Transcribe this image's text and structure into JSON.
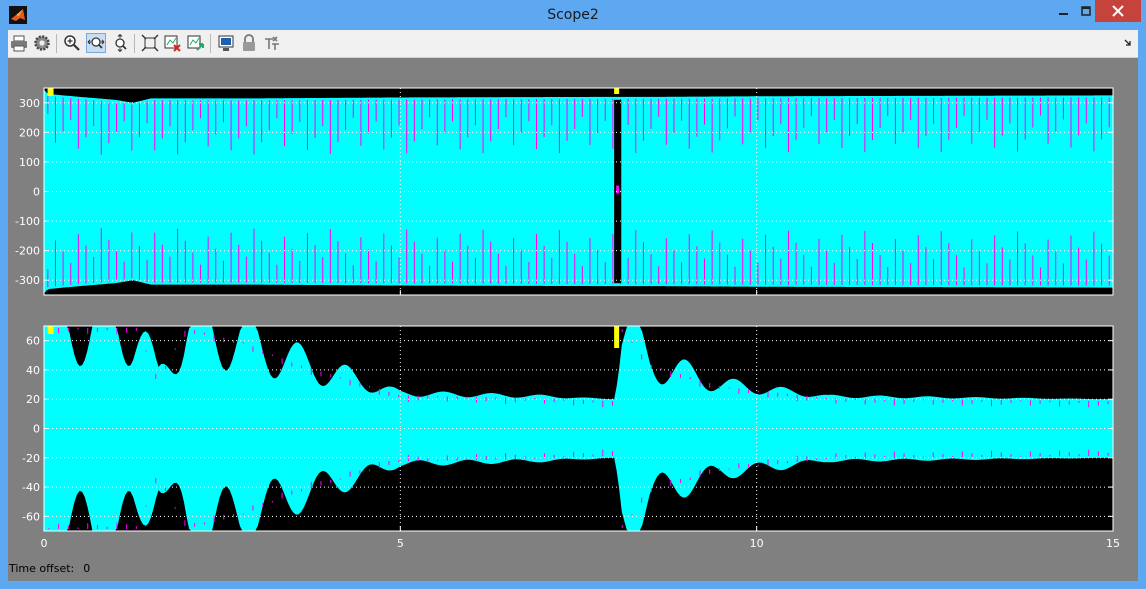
{
  "window": {
    "title": "Scope2"
  },
  "toolbar": {
    "buttons": [
      "printer-icon",
      "parameters-icon",
      "zoom-in-icon",
      "zoom-x-icon",
      "zoom-y-icon",
      "autoscale-icon",
      "save-axes-icon",
      "restore-axes-icon",
      "floating-scope-icon",
      "lock-axes-icon",
      "signal-selection-icon"
    ],
    "active": "zoom-x-icon"
  },
  "status": {
    "time_offset_label": "Time offset:",
    "time_offset_value": "0"
  },
  "colors": {
    "background": "#000000",
    "grid": "#ffffff",
    "cyan": "#00ffff",
    "magenta": "#ff00ff",
    "yellow": "#ffff00",
    "frame": "#808080"
  },
  "chart_data": [
    {
      "type": "line",
      "xlim": [
        0,
        15
      ],
      "ylim": [
        -350,
        350
      ],
      "x_ticks": [
        0,
        5,
        10,
        15
      ],
      "y_ticks": [
        300,
        200,
        100,
        0,
        -100,
        -200,
        -300
      ],
      "grid": true,
      "series": [
        {
          "color": "cyan",
          "envelope_x": [
            0,
            0.05,
            0.5,
            1,
            1.25,
            1.5,
            3,
            5,
            8.0,
            8.1,
            8.6,
            10,
            15
          ],
          "upper": [
            345,
            330,
            320,
            310,
            300,
            315,
            315,
            318,
            320,
            320,
            320,
            322,
            325
          ],
          "lower": [
            -345,
            -330,
            -320,
            -310,
            -300,
            -315,
            -315,
            -318,
            -320,
            -320,
            -320,
            -322,
            -325
          ]
        }
      ],
      "dropout_x": [
        8.0,
        8.1
      ]
    },
    {
      "type": "line",
      "xlim": [
        0,
        15
      ],
      "ylim": [
        -70,
        70
      ],
      "x_ticks": [
        0,
        5,
        10,
        15
      ],
      "y_ticks": [
        60,
        40,
        20,
        0,
        -20,
        -40,
        -60
      ],
      "grid": true,
      "series": [
        {
          "color": "cyan",
          "envelope_x": [
            0,
            0.3,
            0.7,
            1.3,
            1.6,
            2.0,
            2.8,
            3.5,
            5.0,
            7.0,
            8.0,
            8.1,
            8.5,
            9.5,
            11,
            15
          ],
          "upper": [
            70,
            70,
            70,
            70,
            35,
            70,
            60,
            46,
            24,
            22,
            20,
            70,
            45,
            30,
            22,
            20
          ],
          "lower": [
            -70,
            -70,
            -70,
            -70,
            -35,
            -70,
            -60,
            -46,
            -24,
            -22,
            -20,
            -70,
            -45,
            -30,
            -22,
            -20
          ]
        }
      ]
    }
  ]
}
